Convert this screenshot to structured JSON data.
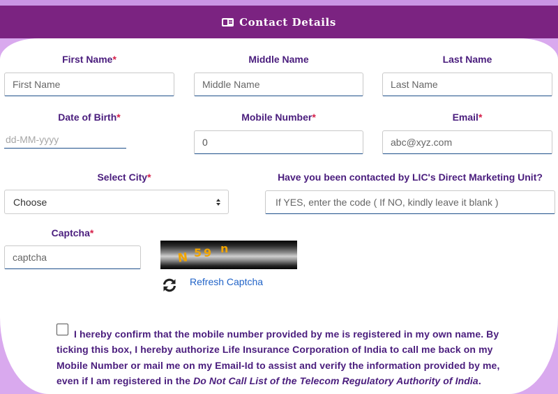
{
  "header": {
    "title": "Contact Details",
    "icon": "contact-card-icon"
  },
  "required_mark": "*",
  "fields": {
    "first_name": {
      "label": "First Name",
      "placeholder": "First Name",
      "required": true
    },
    "middle_name": {
      "label": "Middle Name",
      "placeholder": "Middle Name",
      "required": false
    },
    "last_name": {
      "label": "Last Name",
      "placeholder": "Last Name",
      "required": false
    },
    "dob": {
      "label": "Date of Birth",
      "placeholder": "dd-MM-yyyy",
      "required": true
    },
    "mobile": {
      "label": "Mobile Number",
      "value": "0",
      "required": true
    },
    "email": {
      "label": "Email",
      "placeholder": "abc@xyz.com",
      "required": true
    },
    "city": {
      "label": "Select City",
      "selected": "Choose",
      "required": true
    },
    "lic_dmu": {
      "label": "Have you been contacted by LIC's Direct Marketing Unit?",
      "placeholder": "If YES, enter the code ( If NO, kindly leave it blank )"
    },
    "captcha": {
      "label": "Captcha",
      "placeholder": "captcha",
      "required": true
    }
  },
  "captcha_image": {
    "text": "N59n"
  },
  "refresh": {
    "label": "Refresh Captcha",
    "icon": "refresh-icon"
  },
  "consent": {
    "text_main": "I hereby confirm that the mobile number provided by me is registered in my own name. By ticking this box, I hereby authorize Life Insurance Corporation of India to call me back on my Mobile Number or mail me on my Email-Id to assist and verify the information provided by me, even if I am registered in the ",
    "text_italic": "Do Not Call List of the Telecom Regulatory Authority of India",
    "text_end": ".",
    "checked": false
  },
  "colors": {
    "header_bg": "#7b2381",
    "page_bg": "#d9a9ee",
    "label": "#4a1d7d",
    "required": "#d6204a",
    "link": "#2264c8"
  }
}
